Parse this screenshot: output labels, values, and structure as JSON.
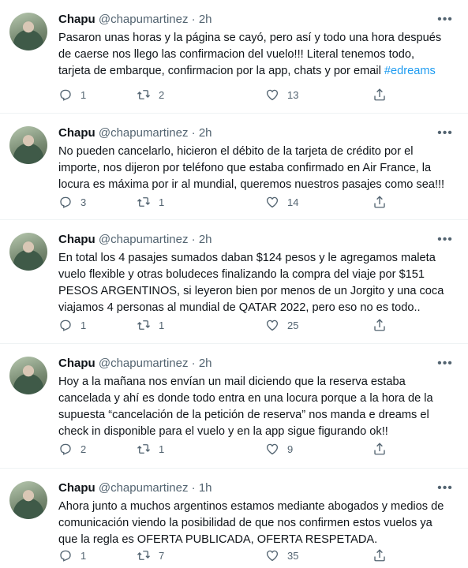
{
  "tweets": [
    {
      "name": "Chapu",
      "handle": "@chapumartinez",
      "dot": "·",
      "time": "2h",
      "text": "Pasaron unas horas y la página se cayó, pero así y todo una hora después\nde caerse nos llego las confirmacion del vuelo!!! Literal tenemos todo,\ntarjeta de embarque, confirmacion por la app, chats y por email ",
      "hashtag": "#edreams",
      "replies": "1",
      "retweets": "2",
      "likes": "13"
    },
    {
      "name": "Chapu",
      "handle": "@chapumartinez",
      "dot": "·",
      "time": "2h",
      "text": "No pueden cancelarlo, hicieron el débito de la tarjeta de crédito por el\nimporte, nos dijeron por teléfono que estaba confirmado en Air France, la\nlocura es máxima por ir al mundial, queremos nuestros pasajes como sea!!!",
      "replies": "3",
      "retweets": "1",
      "likes": "14"
    },
    {
      "name": "Chapu",
      "handle": "@chapumartinez",
      "dot": "·",
      "time": "2h",
      "text": "En total los 4 pasajes sumados daban $124 pesos y le agregamos maleta\nvuelo flexible y otras boludeces finalizando la compra del viaje por $151\nPESOS ARGENTINOS, si leyeron bien por menos de un Jorgito y una coca\nviajamos 4 personas al mundial de QATAR 2022, pero eso no es todo..",
      "replies": "1",
      "retweets": "1",
      "likes": "25"
    },
    {
      "name": "Chapu",
      "handle": "@chapumartinez",
      "dot": "·",
      "time": "2h",
      "text": "Hoy a la mañana nos envían un mail diciendo que la reserva estaba\ncancelada y  ahí es donde todo entra en una locura porque a la hora de la\nsupuesta “cancelación de la petición de reserva” nos manda e dreams el\ncheck in disponible para el vuelo y en la app sigue figurando ok!!",
      "replies": "2",
      "retweets": "1",
      "likes": "9"
    },
    {
      "name": "Chapu",
      "handle": "@chapumartinez",
      "dot": "·",
      "time": "1h",
      "text": "Ahora junto a muchos argentinos estamos mediante abogados y medios de\ncomunicación viendo la posibilidad de que nos confirmen estos vuelos ya\nque la regla es OFERTA PUBLICADA, OFERTA RESPETADA.",
      "replies": "1",
      "retweets": "7",
      "likes": "35"
    }
  ],
  "icons": {
    "reply": "reply-icon",
    "retweet": "retweet-icon",
    "like": "heart-icon",
    "share": "share-icon",
    "more": "more-icon"
  },
  "colors": {
    "text": "#0f1419",
    "secondary": "#536471",
    "hashtag": "#1d9bf0",
    "divider": "#eff3f4"
  }
}
